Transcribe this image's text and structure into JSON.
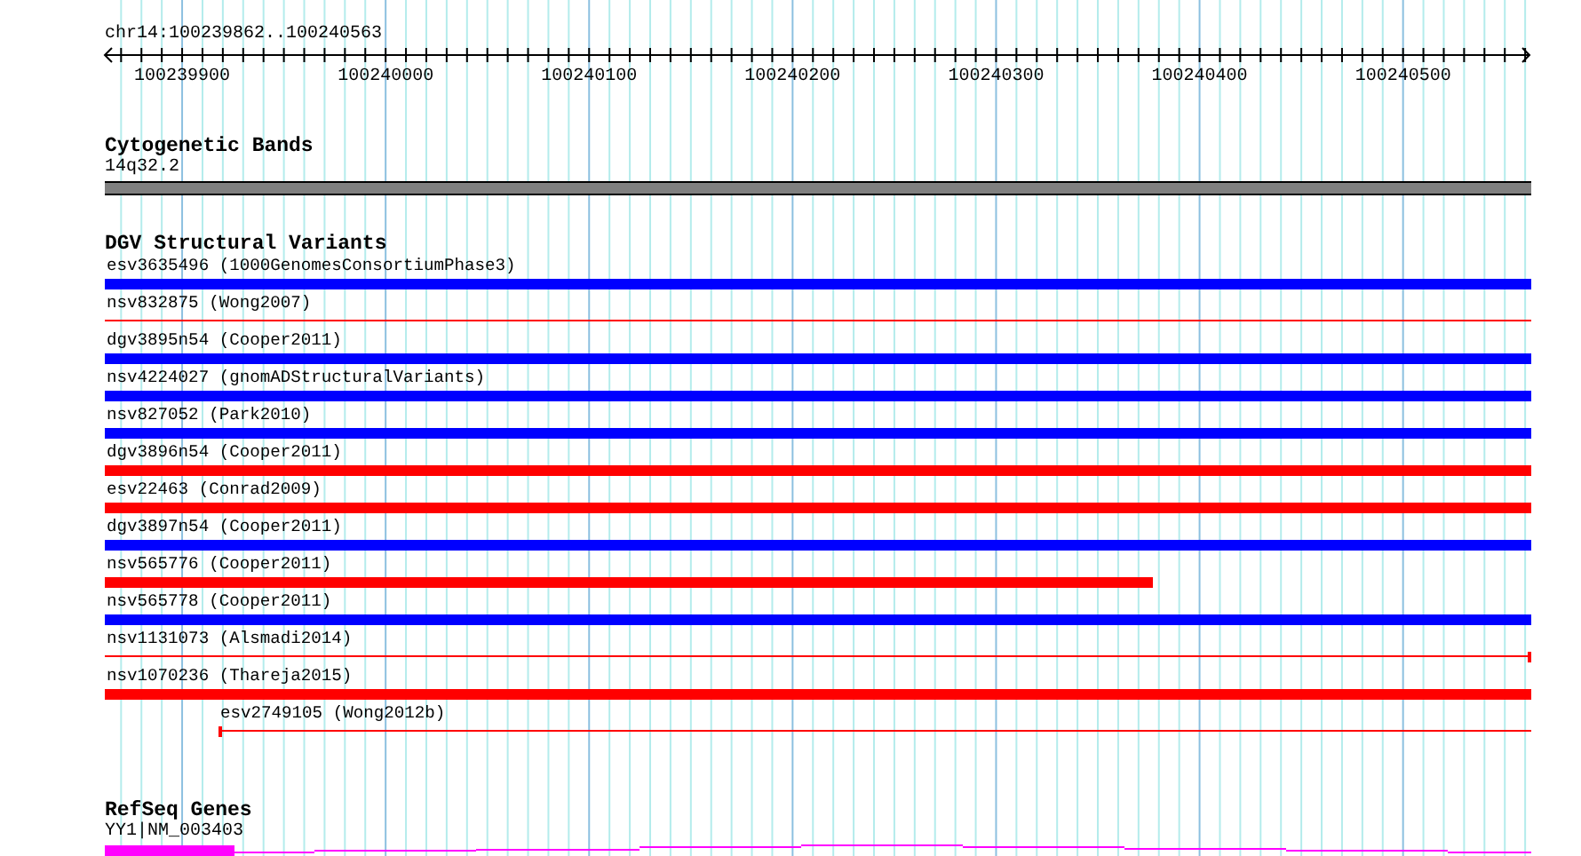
{
  "ruler": {
    "location": "chr14:100239862..100240563",
    "ticks": [
      "100239900",
      "100240000",
      "100240100",
      "100240200",
      "100240300",
      "100240400",
      "100240500"
    ]
  },
  "tracks": [
    {
      "kind": "bands",
      "title": "Cytogenetic Bands",
      "features": [
        {
          "label": "14q32.2"
        }
      ]
    },
    {
      "kind": "variants",
      "title": "DGV Structural Variants",
      "features": [
        {
          "label": "esv3635496 (1000GenomesConsortiumPhase3)",
          "color": "#0000ff",
          "kind": "thick"
        },
        {
          "label": "nsv832875 (Wong2007)",
          "color": "#ff0000",
          "kind": "thin"
        },
        {
          "label": "dgv3895n54 (Cooper2011)",
          "color": "#0000ff",
          "kind": "thick"
        },
        {
          "label": "nsv4224027 (gnomADStructuralVariants)",
          "color": "#0000ff",
          "kind": "thick"
        },
        {
          "label": "nsv827052 (Park2010)",
          "color": "#0000ff",
          "kind": "thick"
        },
        {
          "label": "dgv3896n54 (Cooper2011)",
          "color": "#ff0000",
          "kind": "thick"
        },
        {
          "label": "esv22463 (Conrad2009)",
          "color": "#ff0000",
          "kind": "thick"
        },
        {
          "label": "dgv3897n54 (Cooper2011)",
          "color": "#0000ff",
          "kind": "thick"
        },
        {
          "label": "nsv565776 (Cooper2011)",
          "color": "#ff0000",
          "kind": "thick"
        },
        {
          "label": "nsv565778 (Cooper2011)",
          "color": "#0000ff",
          "kind": "thick"
        },
        {
          "label": "nsv1131073 (Alsmadi2014)",
          "color": "#ff0000",
          "kind": "thin"
        },
        {
          "label": "nsv1070236 (Thareja2015)",
          "color": "#ff0000",
          "kind": "thick"
        },
        {
          "label": "esv2749105 (Wong2012b)",
          "color": "#ff0000",
          "kind": "thin"
        }
      ]
    },
    {
      "kind": "gene",
      "title": "RefSeq Genes",
      "features": [
        {
          "label": "YY1|NM_003403"
        }
      ]
    }
  ]
}
